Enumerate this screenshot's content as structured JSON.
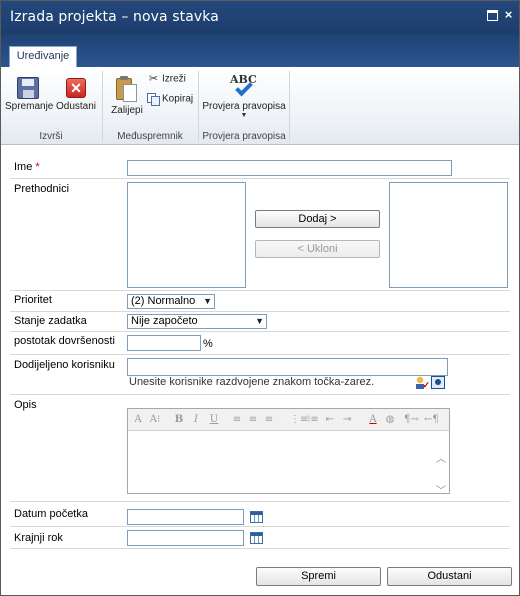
{
  "dialog": {
    "title": "Izrada projekta – nova stavka"
  },
  "ribbon": {
    "tab": "Uređivanje",
    "groups": {
      "commit": {
        "label": "Izvrši",
        "save": "Spremanje",
        "cancel": "Odustani"
      },
      "clipboard": {
        "label": "Međuspremnik",
        "paste": "Zalijepi",
        "cut": "Izreži",
        "copy": "Kopiraj"
      },
      "spelling": {
        "label": "Provjera pravopisa",
        "check": "Provjera pravopisa",
        "icon_text": "ABC"
      }
    }
  },
  "form": {
    "name": {
      "label": "Ime",
      "required_marker": "*",
      "value": ""
    },
    "predecessors": {
      "label": "Prethodnici",
      "add": "Dodaj >",
      "remove": "< Ukloni"
    },
    "priority": {
      "label": "Prioritet",
      "value": "(2) Normalno"
    },
    "status": {
      "label": "Stanje zadatka",
      "value": "Nije započeto"
    },
    "percent": {
      "label": "postotak dovršenosti",
      "value": "",
      "unit": "%"
    },
    "assigned": {
      "label": "Dodijeljeno korisniku",
      "hint": "Unesite korisnike razdvojene znakom točka-zarez."
    },
    "description": {
      "label": "Opis"
    },
    "start_date": {
      "label": "Datum početka"
    },
    "due_date": {
      "label": "Krajnji rok"
    }
  },
  "footer": {
    "save": "Spremi",
    "cancel": "Odustani"
  }
}
